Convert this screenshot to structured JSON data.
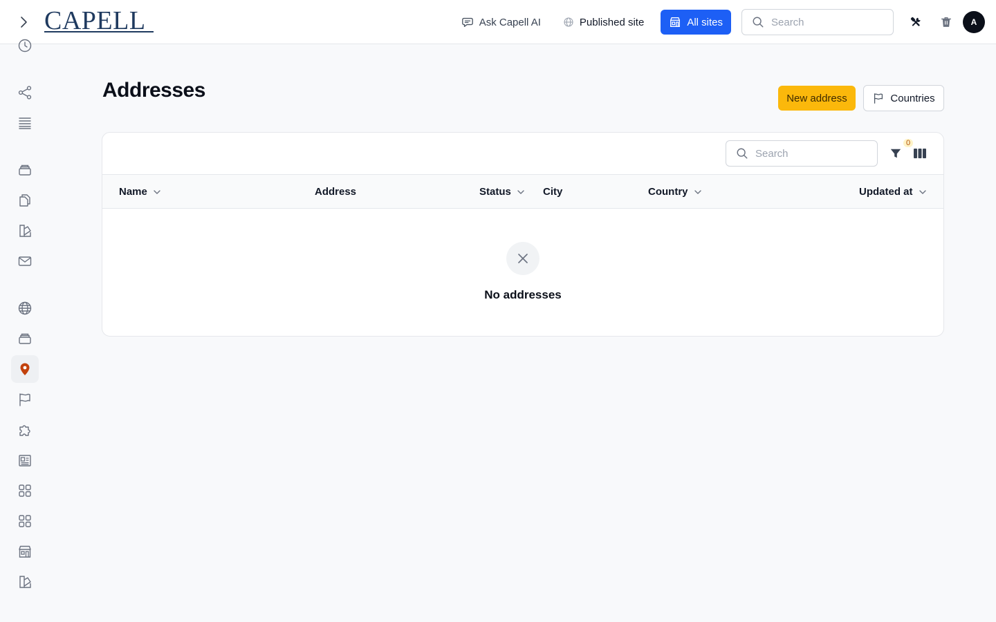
{
  "header": {
    "logo_text": "CAPELL",
    "ask_ai_label": "Ask Capell AI",
    "published_site_label": "Published site",
    "all_sites_label": "All sites",
    "search_placeholder": "Search",
    "avatar_initial": "A"
  },
  "sidebar": {
    "items": [
      {
        "icon": "clock-icon"
      },
      {
        "icon": "share-icon"
      },
      {
        "icon": "list-icon"
      },
      {
        "icon": "inbox-icon"
      },
      {
        "icon": "documents-icon"
      },
      {
        "icon": "swatch-icon"
      },
      {
        "icon": "mail-icon"
      },
      {
        "icon": "globe-icon"
      },
      {
        "icon": "inbox-icon"
      },
      {
        "icon": "map-pin-icon",
        "active": true
      },
      {
        "icon": "flag-icon"
      },
      {
        "icon": "puzzle-icon"
      },
      {
        "icon": "newspaper-icon"
      },
      {
        "icon": "grid-icon"
      },
      {
        "icon": "grid-icon"
      },
      {
        "icon": "storefront-icon"
      },
      {
        "icon": "swatch-icon"
      }
    ],
    "active_color": "#c2410c"
  },
  "page": {
    "title": "Addresses",
    "new_button": "New address",
    "countries_button": "Countries"
  },
  "table": {
    "search_placeholder": "Search",
    "filter_count": "0",
    "columns": [
      {
        "label": "Name",
        "sortable": true
      },
      {
        "label": "Address",
        "sortable": false
      },
      {
        "label": "Status",
        "sortable": true
      },
      {
        "label": "City",
        "sortable": false
      },
      {
        "label": "Country",
        "sortable": true
      },
      {
        "label": "Updated at",
        "sortable": true
      }
    ],
    "empty_message": "No addresses"
  },
  "colors": {
    "primary": "#1d5ff5",
    "accent": "#fbb80b",
    "logo": "#1f3a5f"
  }
}
